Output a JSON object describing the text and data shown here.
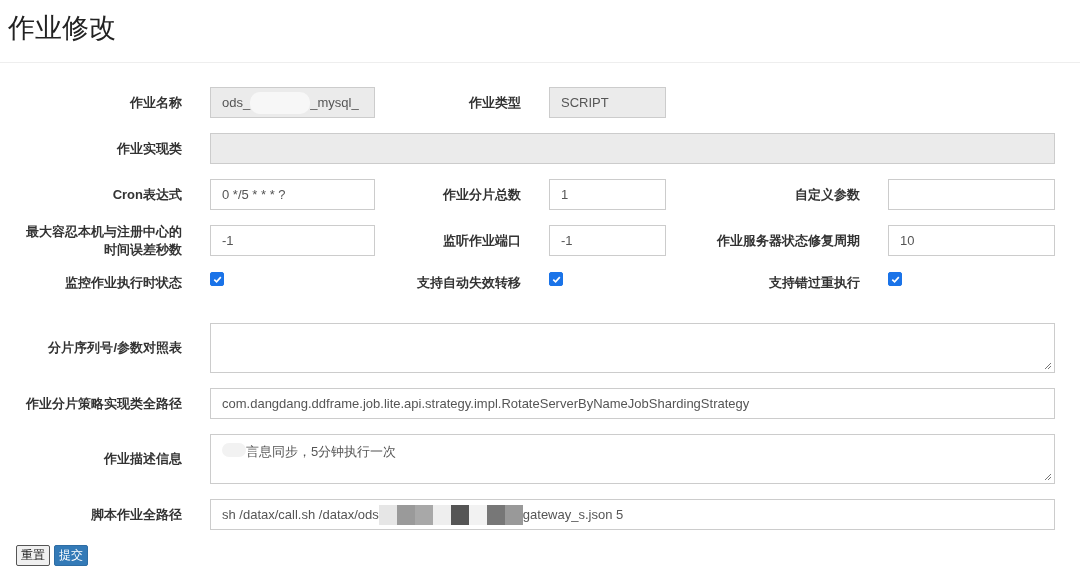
{
  "page": {
    "title": "作业修改"
  },
  "rows": [
    [
      {
        "label": "作业名称",
        "kind": "readonly",
        "segments": [
          {
            "kind": "text",
            "text": "ods_"
          },
          {
            "kind": "blur"
          },
          {
            "kind": "text",
            "text": "_mysql_"
          }
        ]
      },
      {
        "label": "作业类型",
        "kind": "readonly",
        "segments": [
          {
            "kind": "text",
            "text": "SCRIPT"
          }
        ]
      }
    ],
    [
      {
        "label": "作业实现类",
        "kind": "readonly"
      }
    ],
    [
      {
        "label": "Cron表达式",
        "kind": "text",
        "segments": [
          {
            "kind": "text",
            "text": "0 */5 * * * ?"
          }
        ]
      },
      {
        "label": "作业分片总数",
        "kind": "text",
        "segments": [
          {
            "kind": "text",
            "text": "1"
          }
        ]
      },
      {
        "label": "自定义参数",
        "kind": "text"
      }
    ],
    [
      {
        "label": "最大容忍本机与注册中心的时间误差秒数",
        "kind": "text",
        "segments": [
          {
            "kind": "text",
            "text": "-1"
          }
        ]
      },
      {
        "label": "监听作业端口",
        "kind": "text",
        "segments": [
          {
            "kind": "text",
            "text": "-1"
          }
        ]
      },
      {
        "label": "作业服务器状态修复周期",
        "kind": "text",
        "segments": [
          {
            "kind": "text",
            "text": "10"
          }
        ]
      }
    ],
    [
      {
        "label": "监控作业执行时状态",
        "kind": "checkbox",
        "checked": true
      },
      {
        "label": "支持自动失效转移",
        "kind": "checkbox",
        "checked": true
      },
      {
        "label": "支持错过重执行",
        "kind": "checkbox",
        "checked": true
      }
    ],
    [
      {
        "label": "分片序列号/参数对照表",
        "kind": "textarea"
      }
    ],
    [
      {
        "label": "作业分片策略实现类全路径",
        "kind": "text",
        "segments": [
          {
            "kind": "text",
            "text": "com.dangdang.ddframe.job.lite.api.strategy.impl.RotateServerByNameJobShardingStrategy"
          }
        ]
      }
    ],
    [
      {
        "label": "作业描述信息",
        "kind": "textarea",
        "segments": [
          {
            "kind": "blur"
          },
          {
            "kind": "text",
            "text": "言息同步，5分钟执行一次"
          }
        ]
      }
    ],
    [
      {
        "label": "脚本作业全路径",
        "kind": "text",
        "segments": [
          {
            "kind": "text",
            "text": "sh /datax/call.sh /datax/ods"
          },
          {
            "kind": "mosaic"
          },
          {
            "kind": "text",
            "text": "gateway_s.json 5"
          }
        ]
      }
    ]
  ],
  "buttons": [
    {
      "label": "重置",
      "kind": "default"
    },
    {
      "label": "提交",
      "kind": "primary"
    }
  ]
}
